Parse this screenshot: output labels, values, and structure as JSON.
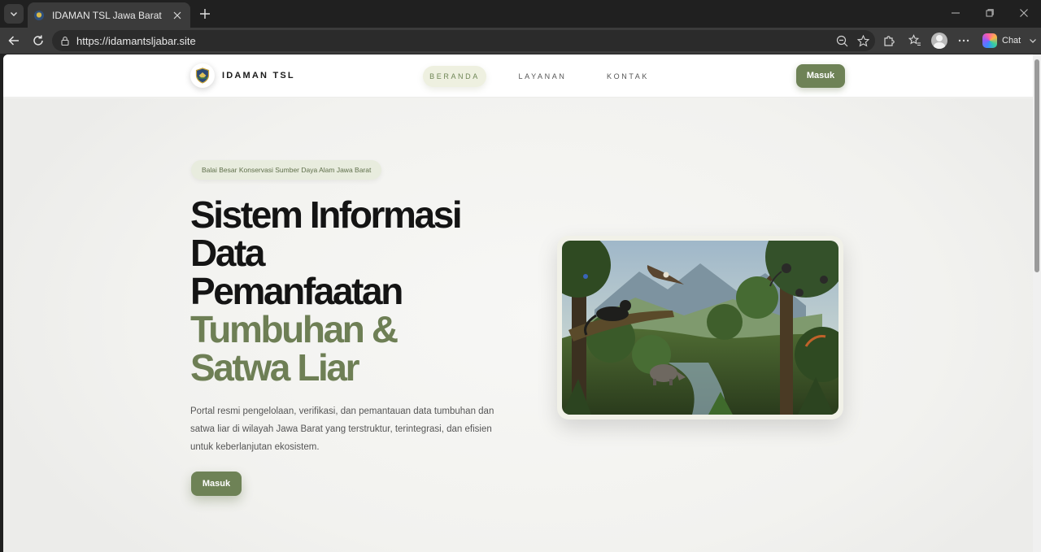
{
  "browser": {
    "tab_title": "IDAMAN TSL Jawa Barat",
    "url": "https://idamantsljabar.site",
    "chat_label": "Chat"
  },
  "site": {
    "brand": "IDAMAN TSL",
    "nav": [
      "BERANDA",
      "LAYANAN",
      "KONTAK"
    ],
    "login_label": "Masuk"
  },
  "hero": {
    "badge": "Balai Besar Konservasi Sumber Daya Alam Jawa Barat",
    "title_lines": [
      "Sistem Informasi",
      "Data",
      "Pemanfaatan"
    ],
    "title_green_lines": [
      "Tumbuhan &",
      "Satwa Liar"
    ],
    "description": "Portal resmi pengelolaan, verifikasi, dan pemantauan data tumbuhan dan satwa liar di wilayah Jawa Barat yang terstruktur, terintegrasi, dan efisien untuk keberlanjutan ekosistem.",
    "cta_label": "Masuk"
  },
  "colors": {
    "accent": "#6e8256",
    "accent_text": "#6e7f55",
    "page_bg": "#f2f2ef"
  }
}
